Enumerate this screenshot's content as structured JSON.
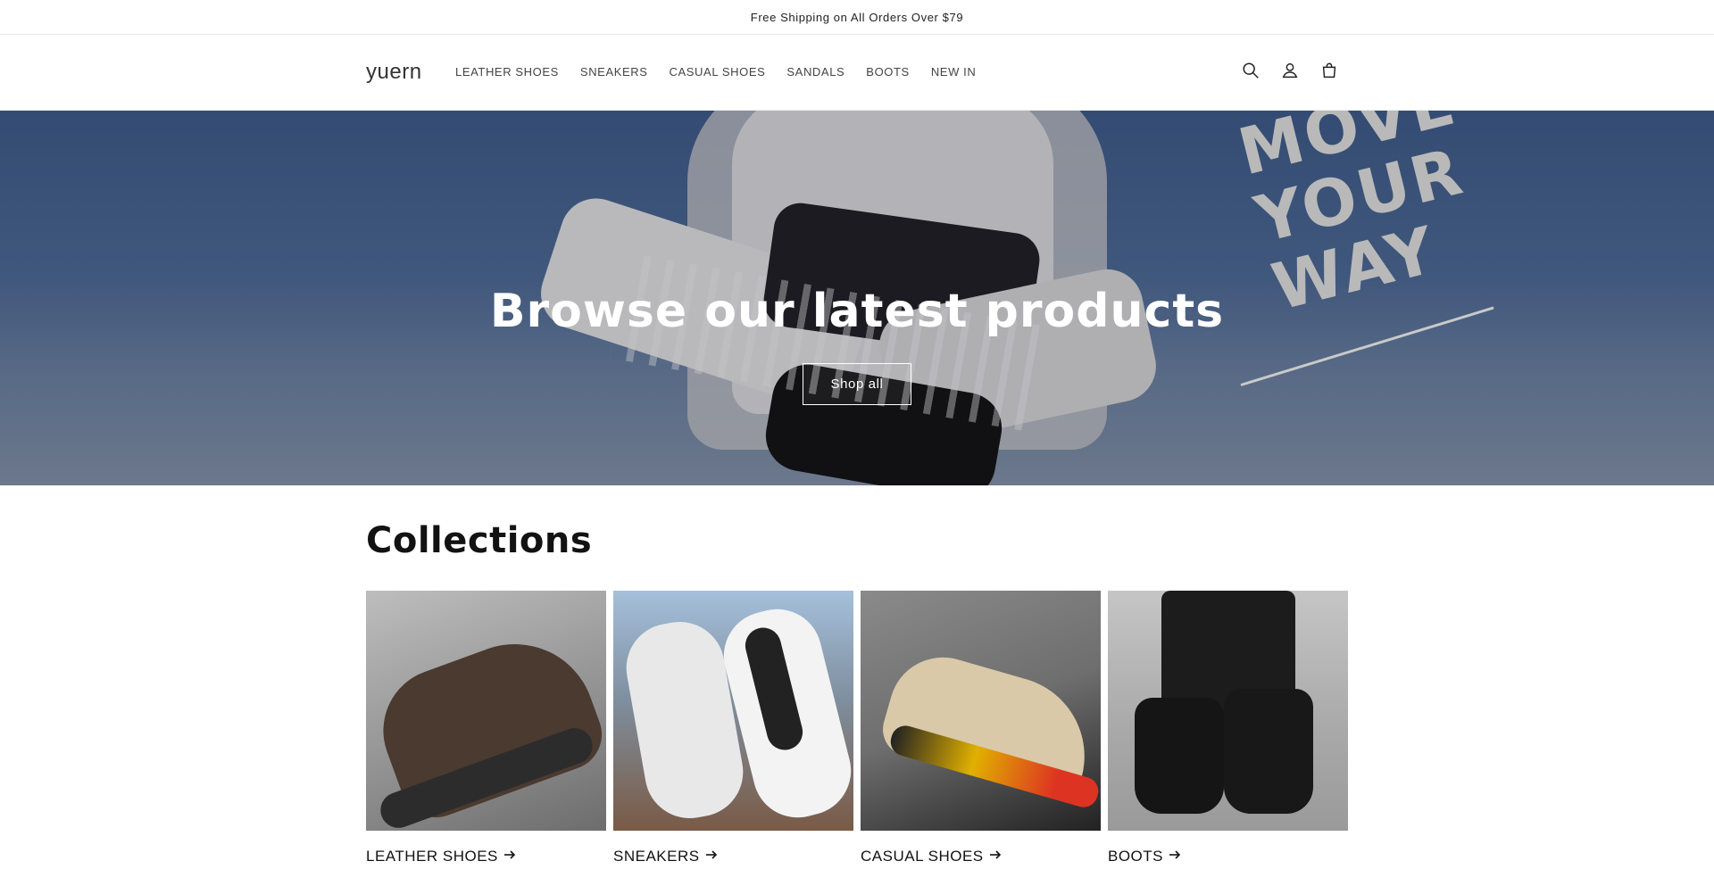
{
  "announcement": {
    "text": "Free Shipping on All Orders Over $79"
  },
  "header": {
    "logo": "yuern",
    "nav": [
      {
        "label": "LEATHER SHOES"
      },
      {
        "label": "SNEAKERS"
      },
      {
        "label": "CASUAL SHOES"
      },
      {
        "label": "SANDALS"
      },
      {
        "label": "BOOTS"
      },
      {
        "label": "NEW IN"
      }
    ],
    "icons": [
      "search-icon",
      "account-icon",
      "cart-icon"
    ]
  },
  "hero": {
    "slogan": [
      "MOVE",
      "YOUR",
      "WAY"
    ],
    "title": "Browse our latest products",
    "button_label": "Shop all"
  },
  "collections": {
    "title": "Collections",
    "items": [
      {
        "label": "LEATHER SHOES"
      },
      {
        "label": "SNEAKERS"
      },
      {
        "label": "CASUAL SHOES"
      },
      {
        "label": "BOOTS"
      }
    ]
  }
}
